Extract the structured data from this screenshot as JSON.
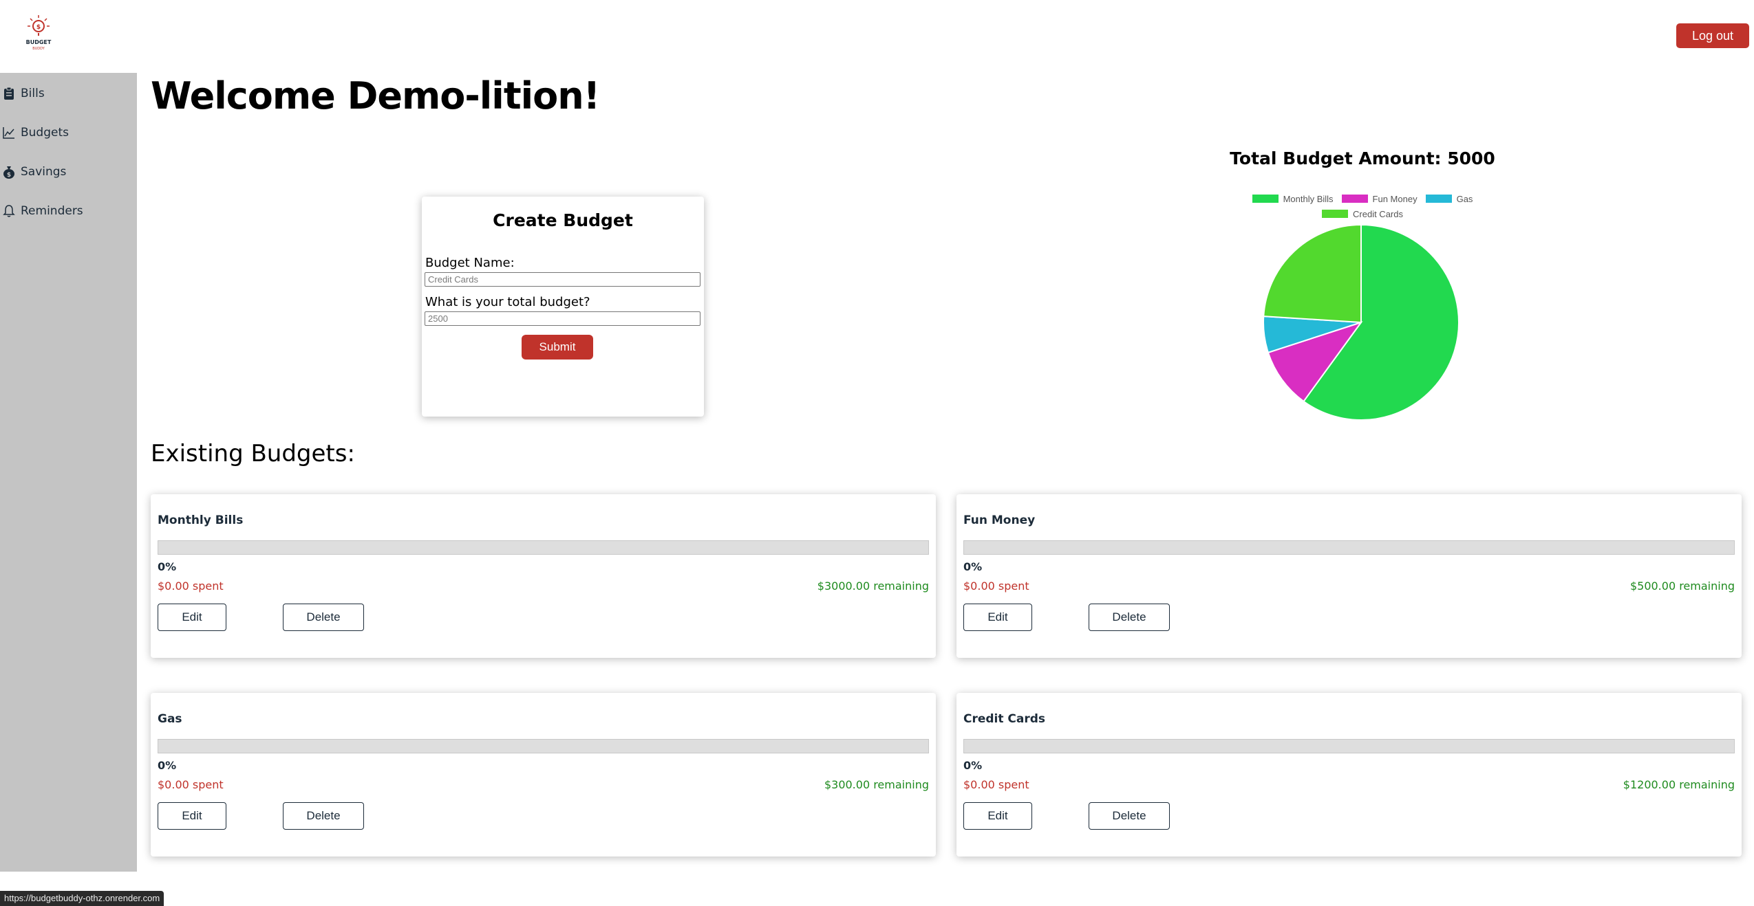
{
  "header": {
    "logo_text": "BUDGET BUDDY",
    "logout_label": "Log out"
  },
  "sidebar": {
    "items": [
      {
        "label": "Bills",
        "icon": "clipboard-icon"
      },
      {
        "label": "Budgets",
        "icon": "line-chart-icon"
      },
      {
        "label": "Savings",
        "icon": "money-bag-icon"
      },
      {
        "label": "Reminders",
        "icon": "bell-icon"
      }
    ]
  },
  "main": {
    "welcome": "Welcome Demo-lition!",
    "existing_heading": "Existing Budgets:"
  },
  "create_budget": {
    "title": "Create Budget",
    "name_label": "Budget Name:",
    "name_placeholder": "Credit Cards",
    "total_label": "What is your total budget?",
    "total_placeholder": "2500",
    "submit_label": "Submit"
  },
  "chart_data": {
    "type": "pie",
    "title": "Total Budget Amount: 5000",
    "categories": [
      "Monthly Bills",
      "Fun Money",
      "Gas",
      "Credit Cards"
    ],
    "values": [
      3000,
      500,
      300,
      1200
    ],
    "colors": [
      "#22d94f",
      "#d92ec2",
      "#25b9d7",
      "#52d92e"
    ],
    "legend_position": "top"
  },
  "budgets": [
    {
      "name": "Monthly Bills",
      "progress_percent": 0,
      "percent_label": "0%",
      "spent": "$0.00 spent",
      "remaining": "$3000.00 remaining",
      "edit_label": "Edit",
      "delete_label": "Delete"
    },
    {
      "name": "Fun Money",
      "progress_percent": 0,
      "percent_label": "0%",
      "spent": "$0.00 spent",
      "remaining": "$500.00 remaining",
      "edit_label": "Edit",
      "delete_label": "Delete"
    },
    {
      "name": "Gas",
      "progress_percent": 0,
      "percent_label": "0%",
      "spent": "$0.00 spent",
      "remaining": "$300.00 remaining",
      "edit_label": "Edit",
      "delete_label": "Delete"
    },
    {
      "name": "Credit Cards",
      "progress_percent": 0,
      "percent_label": "0%",
      "spent": "$0.00 spent",
      "remaining": "$1200.00 remaining",
      "edit_label": "Edit",
      "delete_label": "Delete"
    }
  ],
  "status_bar": {
    "url": "https://budgetbuddy-othz.onrender.com"
  },
  "colors": {
    "accent_red": "#c0332b",
    "sidebar_bg": "#c4c4c4",
    "spent_red": "#c0332b",
    "remaining_green": "#1f8b1f"
  }
}
